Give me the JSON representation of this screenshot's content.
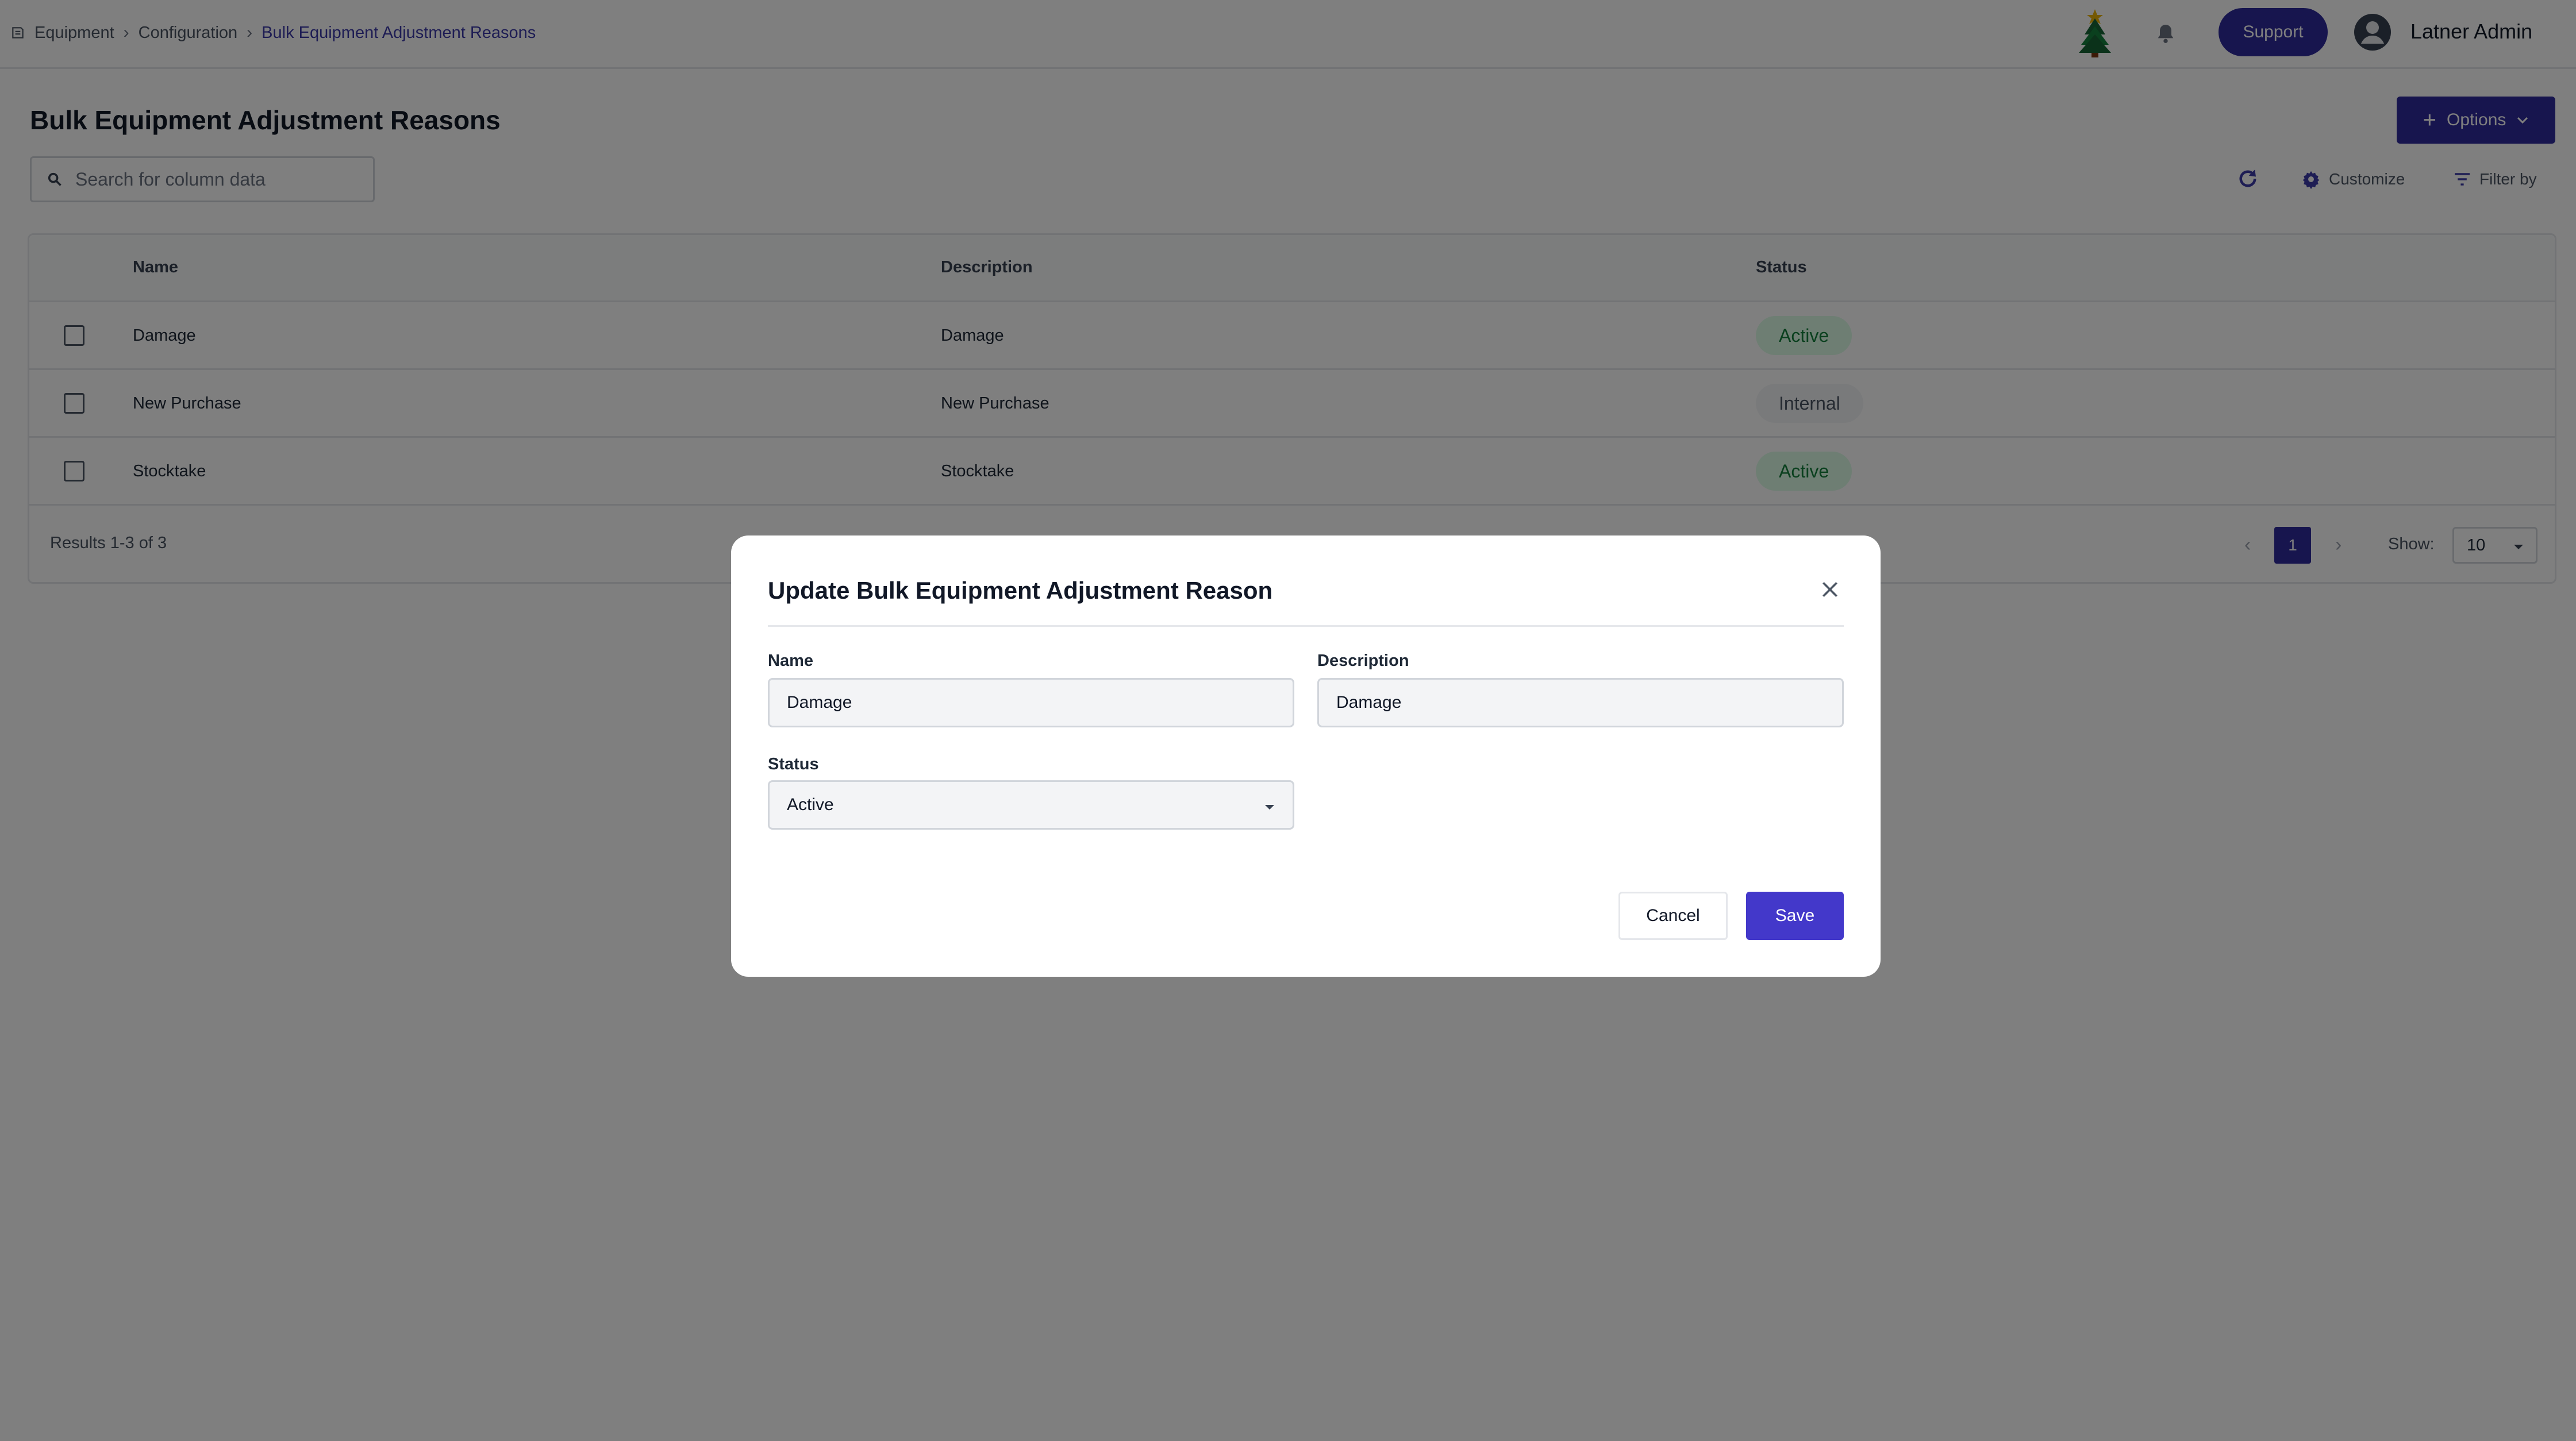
{
  "breadcrumb": {
    "items": [
      "Equipment",
      "Configuration",
      "Bulk Equipment Adjustment Reasons"
    ]
  },
  "header": {
    "support_label": "Support",
    "user_name": "Latner Admin"
  },
  "page": {
    "title": "Bulk Equipment Adjustment Reasons",
    "options_label": "Options",
    "search_placeholder": "Search for column data",
    "customize_label": "Customize",
    "filter_label": "Filter by"
  },
  "table": {
    "columns": [
      "Name",
      "Description",
      "Status"
    ],
    "rows": [
      {
        "name": "Damage",
        "description": "Damage",
        "status": "Active"
      },
      {
        "name": "New Purchase",
        "description": "New Purchase",
        "status": "Internal"
      },
      {
        "name": "Stocktake",
        "description": "Stocktake",
        "status": "Active"
      }
    ],
    "results_text": "Results 1-3 of 3",
    "current_page": "1",
    "show_label": "Show:",
    "page_size": "10"
  },
  "modal": {
    "title": "Update Bulk Equipment Adjustment Reason",
    "name_label": "Name",
    "name_value": "Damage",
    "description_label": "Description",
    "description_value": "Damage",
    "status_label": "Status",
    "status_value": "Active",
    "cancel_label": "Cancel",
    "save_label": "Save"
  },
  "colors": {
    "primary": "#2f2a9c",
    "save": "#4338ca",
    "active_badge_bg": "#dcfce7",
    "active_badge_text": "#15803d"
  },
  "icons": [
    "list-icon",
    "chevron-right-icon",
    "christmas-tree-icon",
    "bell-icon",
    "avatar-icon",
    "plus-icon",
    "chevron-down-icon",
    "search-icon",
    "refresh-icon",
    "gear-icon",
    "filter-icon",
    "close-icon"
  ]
}
